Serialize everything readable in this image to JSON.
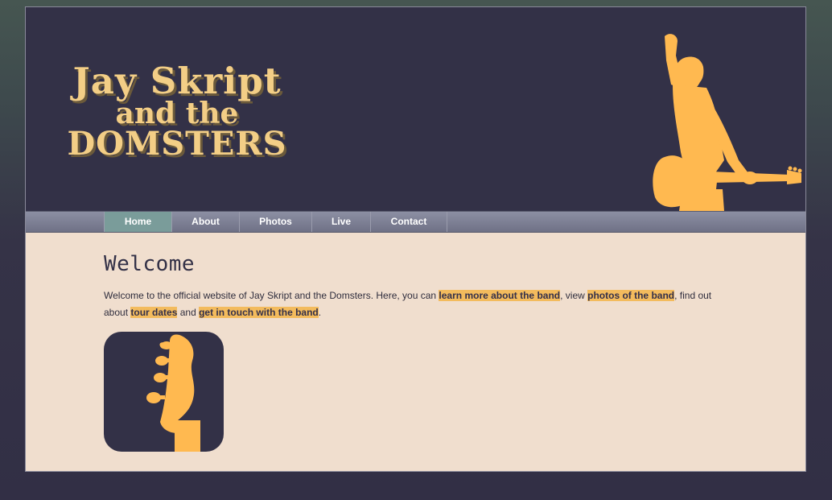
{
  "header": {
    "logo_line1": "Jay Skript",
    "logo_line2": "and the",
    "logo_line3": "DOMSTERS"
  },
  "nav": {
    "items": [
      {
        "label": "Home",
        "active": true
      },
      {
        "label": "About",
        "active": false
      },
      {
        "label": "Photos",
        "active": false
      },
      {
        "label": "Live",
        "active": false
      },
      {
        "label": "Contact",
        "active": false
      }
    ]
  },
  "main": {
    "title": "Welcome",
    "intro_part1": "Welcome to the official website of Jay Skript and the Domsters. Here, you can ",
    "link_about": "learn more about the band",
    "intro_part2": ", view ",
    "link_photos": "photos of the band",
    "intro_part3": ", find out about ",
    "link_live": "tour dates",
    "intro_part4": " and ",
    "link_contact": "get in touch with the band",
    "intro_part5": "."
  },
  "colors": {
    "header_bg": "#333147",
    "accent": "#f3bb5d",
    "content_bg": "#f0dece",
    "nav_active": "#7a9c9a"
  }
}
